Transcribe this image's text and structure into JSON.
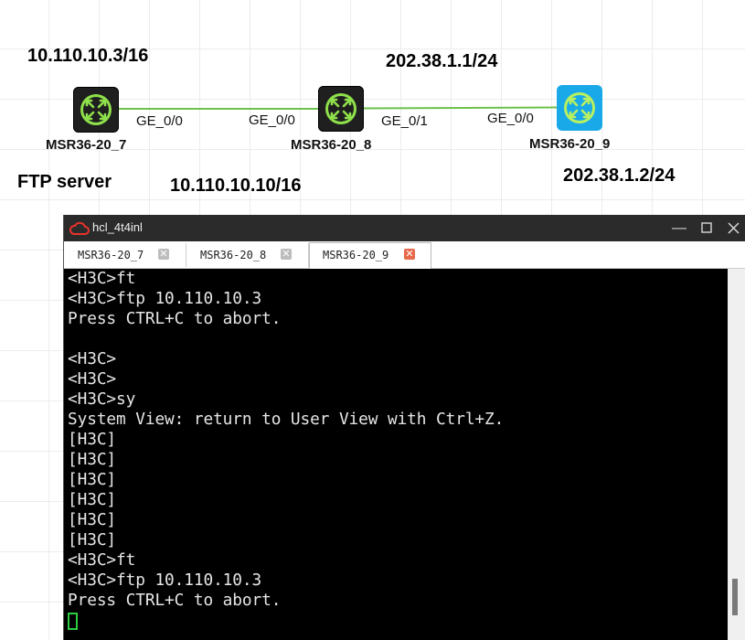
{
  "topology": {
    "ip_labels": {
      "r7_net": "10.110.10.3/16",
      "r8_top": "202.38.1.1/24",
      "r8_bottom": "10.110.10.10/16",
      "r9_net": "202.38.1.2/24",
      "ftp_server": "FTP server"
    },
    "devices": [
      {
        "name": "MSR36-20_7",
        "icon": "router-icon",
        "color": "#1f1f1f"
      },
      {
        "name": "MSR36-20_8",
        "icon": "router-icon",
        "color": "#1f1f1f"
      },
      {
        "name": "MSR36-20_9",
        "icon": "router-icon",
        "color": "#19a9e8"
      }
    ],
    "ports": {
      "r7_ge00": "GE_0/0",
      "r8_ge00": "GE_0/0",
      "r8_ge01": "GE_0/1",
      "r9_ge00": "GE_0/0"
    },
    "link_color": "#6cc24a"
  },
  "window": {
    "title": "hcl_4t4inl",
    "tabs": [
      {
        "label": "MSR36-20_7",
        "active": false
      },
      {
        "label": "MSR36-20_8",
        "active": false
      },
      {
        "label": "MSR36-20_9",
        "active": true
      }
    ]
  },
  "console": {
    "lines": [
      "<H3C>ft",
      "<H3C>ftp 10.110.10.3",
      "Press CTRL+C to abort.",
      "",
      "<H3C>",
      "<H3C>",
      "<H3C>sy",
      "System View: return to User View with Ctrl+Z.",
      "[H3C]",
      "[H3C]",
      "[H3C]",
      "[H3C]",
      "[H3C]",
      "[H3C]",
      "<H3C>ft",
      "<H3C>ftp 10.110.10.3",
      "Press CTRL+C to abort."
    ]
  }
}
